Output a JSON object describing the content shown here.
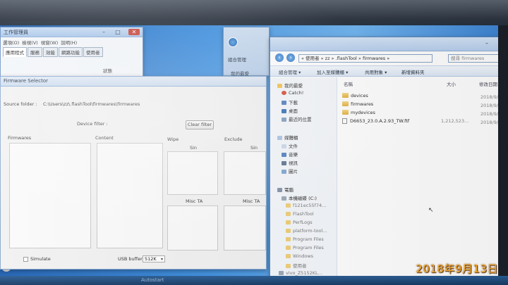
{
  "taskman": {
    "title": "工作管理員",
    "menu": [
      "選項(O)",
      "檢視(V)",
      "視窗(W)",
      "說明(H)"
    ],
    "tabs": [
      "應用程式",
      "服務",
      "效能",
      "網路功能",
      "使用者"
    ],
    "status_header": "狀態"
  },
  "midwin": {
    "organize": "組合管理",
    "favorites": "我的最愛"
  },
  "fwsel": {
    "title": "Firmware Selector",
    "source_label": "Source folder :",
    "source_path": "C:\\Users\\zz\\.flashTool\\firmwares\\firmwares",
    "device_filter_label": "Device filter :",
    "clear_filter": "Clear filter",
    "col_firmwares": "Firmwares",
    "col_content": "Content",
    "col_wipe": "Wipe",
    "col_exclude": "Exclude",
    "sin_1": "Sin",
    "sin_2": "Sin",
    "misc_ta_1": "Misc TA",
    "misc_ta_2": "Misc TA",
    "simulate": "Simulate",
    "usb_buffer_label": "USB buffer",
    "usb_buffer_value": "512K"
  },
  "explorer": {
    "address": "« 使用者 » zz » .flashTool » firmwares »",
    "search_placeholder": "搜尋 firmwares",
    "toolbar": [
      "組合管理 ▾",
      "加入至媒體櫃 ▾",
      "共用對象 ▾",
      "新增資料夾"
    ],
    "nav": {
      "favorites": "我的最愛",
      "catch": "Catch!",
      "downloads": "下載",
      "desktop": "桌面",
      "recent": "最近的位置",
      "libraries": "媒體櫃",
      "documents": "文件",
      "music": "音樂",
      "videos": "視訊",
      "pictures": "圖片",
      "computer": "電腦",
      "local_disk": "本機磁碟 (C:)",
      "sub_1": "f121ec55f74...",
      "sub_2": "FlashTool",
      "sub_3": "PerfLogs",
      "sub_4": "platform-tool...",
      "sub_5": "Program Files",
      "sub_6": "Program Files",
      "sub_7": "Windows",
      "sub_8": "使用者",
      "sub_9": "vivo_Z5152KL..."
    },
    "columns": {
      "name": "名稱",
      "date": "修改日期",
      "size": "大小"
    },
    "rows": [
      {
        "name": "devices",
        "date": "2018/9/13 下午",
        "size": ""
      },
      {
        "name": "firmwares",
        "date": "2018/9/13 下午",
        "size": ""
      },
      {
        "name": "mydevices",
        "date": "2018/9/13 下午",
        "size": ""
      },
      {
        "name": "D6653_23.0.A.2.93_TW.ftf",
        "date": "2018/9/13 上午",
        "size": "1,212,523..."
      }
    ]
  },
  "taskbar": {
    "text": "Autostart"
  },
  "timestamp": "2018年9月13日"
}
